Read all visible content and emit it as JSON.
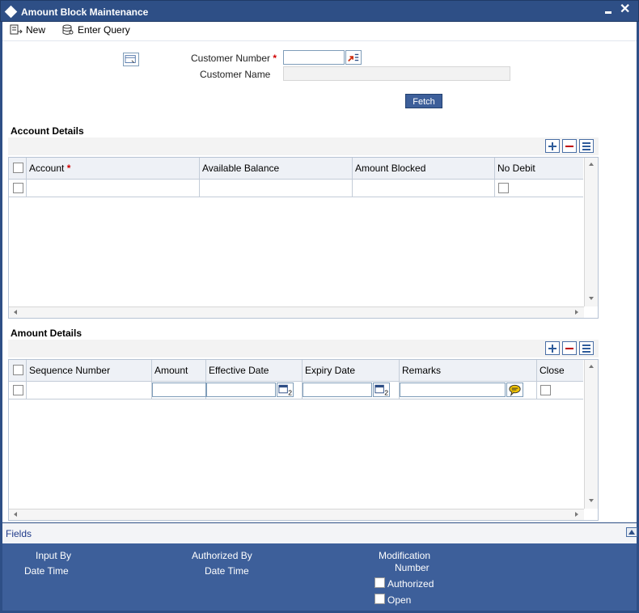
{
  "window": {
    "title": "Amount Block Maintenance"
  },
  "toolbar": {
    "new_label": "New",
    "enter_query_label": "Enter Query"
  },
  "form": {
    "customer_number_label": "Customer Number",
    "customer_number_value": "",
    "customer_name_label": "Customer Name",
    "customer_name_value": "",
    "fetch_label": "Fetch"
  },
  "account_details": {
    "title": "Account Details",
    "columns": [
      "Account",
      "Available Balance",
      "Amount Blocked",
      "No Debit"
    ]
  },
  "amount_details": {
    "title": "Amount Details",
    "columns": [
      "Sequence Number",
      "Amount",
      "Effective Date",
      "Expiry Date",
      "Remarks",
      "Close"
    ]
  },
  "footer": {
    "fields_label": "Fields",
    "input_by": "Input By",
    "date_time_1": "Date Time",
    "authorized_by": "Authorized By",
    "date_time_2": "Date Time",
    "modification": "Modification",
    "number": "Number",
    "authorized": "Authorized",
    "open": "Open"
  }
}
